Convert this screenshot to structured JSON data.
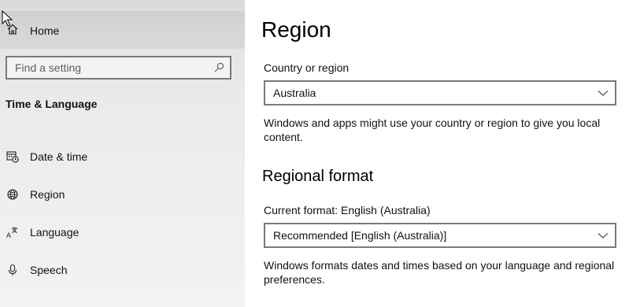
{
  "sidebar": {
    "home_label": "Home",
    "search_placeholder": "Find a setting",
    "section_heading": "Time & Language",
    "items": [
      {
        "label": "Date & time",
        "icon": "date-time-icon"
      },
      {
        "label": "Region",
        "icon": "globe-icon"
      },
      {
        "label": "Language",
        "icon": "language-icon"
      },
      {
        "label": "Speech",
        "icon": "microphone-icon"
      }
    ]
  },
  "main": {
    "title": "Region",
    "country": {
      "label": "Country or region",
      "value": "Australia",
      "description": "Windows and apps might use your country or region to give you local content."
    },
    "regional_format": {
      "heading": "Regional format",
      "current_label": "Current format: English (Australia)",
      "value": "Recommended [English (Australia)]",
      "description": "Windows formats dates and times based on your language and regional preferences."
    }
  },
  "colors": {
    "sidebar_bg": "#eaeaea",
    "border": "#7a7a7a",
    "text": "#111111"
  }
}
